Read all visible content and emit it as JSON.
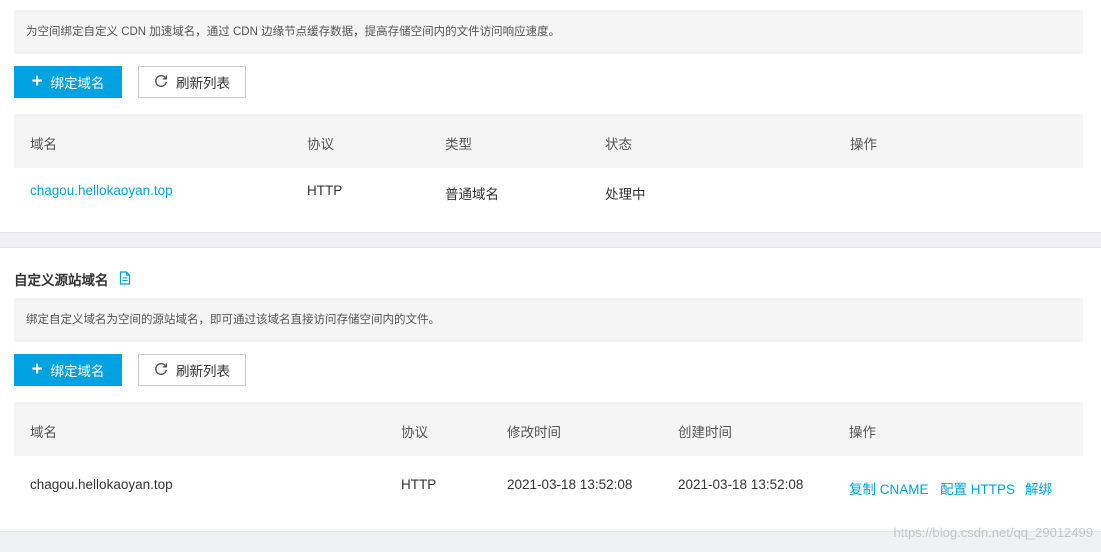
{
  "cdn_domain": {
    "notice": "为空间绑定自定义 CDN 加速域名，通过 CDN 边缘节点缓存数据，提高存储空间内的文件访问响应速度。",
    "bind_button": "绑定域名",
    "refresh_button": "刷新列表",
    "columns": [
      "域名",
      "协议",
      "类型",
      "状态",
      "操作"
    ],
    "rows": [
      {
        "domain": "chagou.hellokaoyan.top",
        "protocol": "HTTP",
        "type": "普通域名",
        "status": "处理中"
      }
    ]
  },
  "source_domain": {
    "title": "自定义源站域名",
    "notice": "绑定自定义域名为空间的源站域名，即可通过该域名直接访问存储空间内的文件。",
    "bind_button": "绑定域名",
    "refresh_button": "刷新列表",
    "columns": [
      "域名",
      "协议",
      "修改时间",
      "创建时间",
      "操作"
    ],
    "rows": [
      {
        "domain": "chagou.hellokaoyan.top",
        "protocol": "HTTP",
        "modified": "2021-03-18 13:52:08",
        "created": "2021-03-18 13:52:08",
        "actions": [
          "复制 CNAME",
          "配置 HTTPS",
          "解绑"
        ]
      }
    ]
  },
  "watermark": "https://blog.csdn.net/qq_29012499",
  "colors": {
    "accent": "#00a2e0",
    "panel": "#f5f5f6",
    "page_bg": "#f0f1f3"
  },
  "icons": {
    "plus": "plus-icon",
    "refresh": "refresh-icon",
    "doc": "document-icon"
  }
}
